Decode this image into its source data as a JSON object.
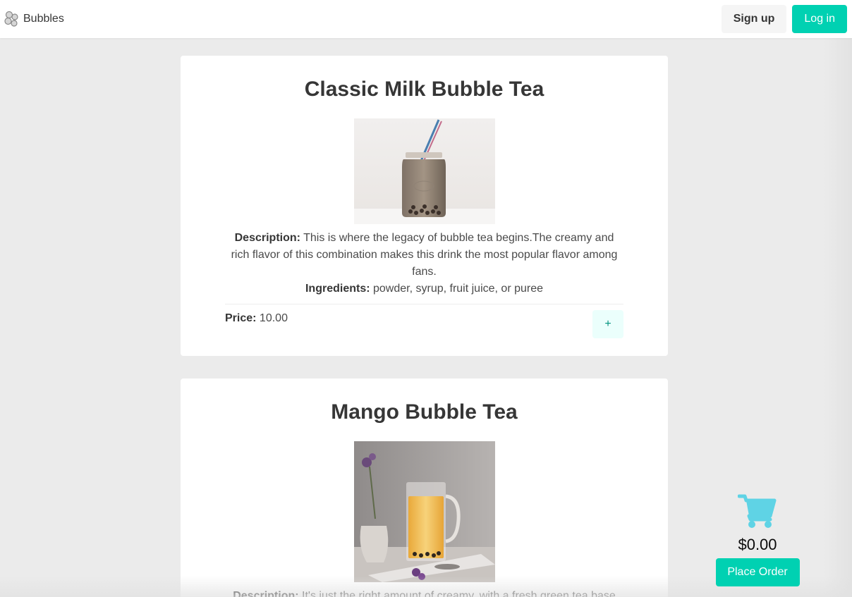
{
  "navbar": {
    "brand_name": "Bubbles",
    "brand_icon": "bubbles-logo-icon",
    "signup_label": "Sign up",
    "login_label": "Log in"
  },
  "products": [
    {
      "title": "Classic Milk Bubble Tea",
      "image": "classic-milk-tea-photo",
      "description_label": "Description:",
      "description": "This is where the legacy of bubble tea begins.The creamy and rich flavor of this combination makes this drink the most popular flavor among fans.",
      "ingredients_label": "Ingredients:",
      "ingredients": "powder, syrup, fruit juice, or puree",
      "price_label": "Price:",
      "price": "10.00",
      "add_label": "+"
    },
    {
      "title": "Mango Bubble Tea",
      "image": "mango-tea-photo",
      "description_label": "Description:",
      "description": "It's just the right amount of creamy, with a fresh green tea base"
    }
  ],
  "cart": {
    "icon": "shopping-cart-icon",
    "total": "$0.00",
    "place_order_label": "Place Order"
  },
  "colors": {
    "primary": "#00d1b2",
    "cart_icon": "#5fd3e5",
    "background": "#ebebeb"
  }
}
